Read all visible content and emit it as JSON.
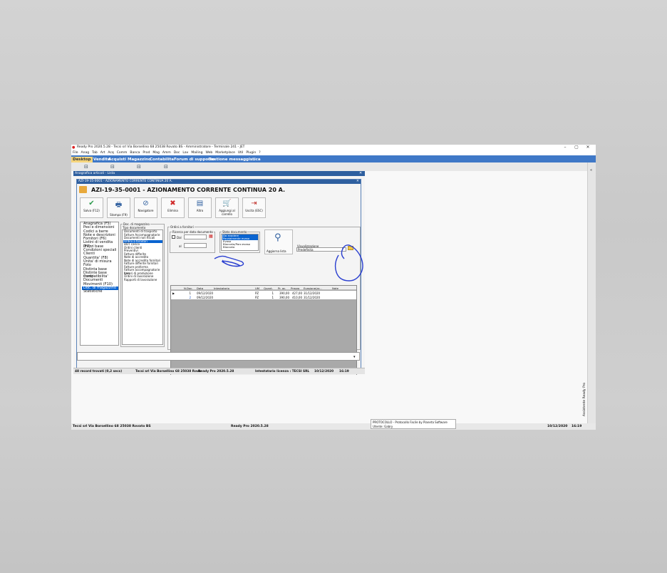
{
  "window": {
    "title": "Ready Pro 2020.5.28 - Tecsi srl Via Borsellino 68 25038 Rovato BS - Amministratore - Terminale 241 - JET",
    "controls": [
      "–",
      "▢",
      "✕"
    ]
  },
  "menubar": [
    "File",
    "Anag",
    "Tab",
    "Art",
    "Acq",
    "Comm",
    "Banca",
    "Prod",
    "Mag",
    "Amm",
    "Doc",
    "Lav",
    "Mailing",
    "Web",
    "Marketplace",
    "Util",
    "Plugin",
    "?"
  ],
  "tabs": [
    "Desktop",
    "Vendite",
    "Acquisti",
    "Magazzino",
    "Contabilita'",
    "Forum di supporto",
    "Gestione messaggistica",
    "..."
  ],
  "list_window": {
    "title": "Anagrafica articoli - Lista"
  },
  "detail_window": {
    "title": "AZI-19-35-0001 - AZIONAMENTO CORRENTE CONTINUA 20 A.",
    "heading": "AZI-19-35-0001 - AZIONAMENTO CORRENTE CONTINUA 20 A."
  },
  "toolbar": [
    {
      "icon": "check-icon",
      "glyph": "✔",
      "color": "#2e9b4e",
      "label": "Salva (F12)"
    },
    {
      "icon": "printer-icon",
      "glyph": "🖶",
      "color": "#2f5f9f",
      "label": "Stampa (F9)"
    },
    {
      "icon": "compass-icon",
      "glyph": "⊘",
      "color": "#2f5f9f",
      "label": "Navigatore"
    },
    {
      "icon": "close-icon",
      "glyph": "✖",
      "color": "#d02a2a",
      "label": "Elimina"
    },
    {
      "icon": "document-icon",
      "glyph": "▤",
      "color": "#2f5f9f",
      "label": "Altro"
    },
    {
      "icon": "cart-icon",
      "glyph": "🛒",
      "color": "#2f5f9f",
      "label": "Aggiungi al carrello"
    },
    {
      "icon": "exit-icon",
      "glyph": "⇥",
      "color": "#c0302a",
      "label": "Uscita (ESC)"
    }
  ],
  "nav": {
    "items": [
      "Anagrafica (F5)",
      "Pesi e dimensioni",
      "Codici a barre",
      "Note e descrizioni",
      "Fornitori (F6)",
      "Listini di vendita (F7)",
      "Prezzi base",
      "Condizioni speciali",
      "Clienti",
      "Quantita' (F8)",
      "Unita' di misura",
      "Foto",
      "Distinta base",
      "Distinte base madri",
      "Compatibilita'",
      "Documenti",
      "Movimenti (F10)",
      "Doc. di magazzino",
      "Statistiche"
    ],
    "selected": 17
  },
  "doc_types": {
    "group_title": "Doc. di magazzino",
    "header": "Tipo documento",
    "items": [
      "Documenti di trasporto",
      "Fatture Accompagnatorie",
      "Documenti non fiscali",
      "Ordini a fornitori",
      "DDT carico",
      "Ordini clienti",
      "Preventivi",
      "Fatture differite",
      "Note di accredito",
      "Note di accredito fornitori",
      "Fatture differite fornitori",
      "Fatture proforma",
      "Fatture accompagnatorie forn",
      "Lavori di produzione",
      "Ordini di lavorazione",
      "Rapporti di lavorazione"
    ],
    "selected": 3
  },
  "filters": {
    "group_title": "Ordini a fornitori",
    "ricerca_title": "Ricerca per data documento",
    "dal_label": "Dal",
    "al_label": "al",
    "stato_title": "Stato documento",
    "stato_items": [
      "Da evadere",
      "Parzialmente evaso",
      "Evaso",
      "Bloccato/Parz.evaso",
      "Bloccato"
    ],
    "stato_selected": [
      0,
      1
    ],
    "refresh_label": "Aggiorna lista",
    "visualizzazione_label": "Visualizzazione",
    "visualizzazione_value": "Predefinita"
  },
  "grid": {
    "columns": [
      "N.Doc.",
      "Data",
      "Intestatario",
      "UM",
      "Quant.",
      "Pr. ac.",
      "Prezzo",
      "Evasione(ar...",
      "Note"
    ],
    "rows": [
      [
        "1",
        "09/12/2020",
        "",
        "PZ",
        "1",
        "390,00",
        "427,00",
        "31/12/2020",
        ""
      ],
      [
        "2",
        "09/12/2020",
        "",
        "PZ",
        "1",
        "390,00",
        "410,00",
        "31/12/2020",
        ""
      ]
    ]
  },
  "status": {
    "records": "48 record trovati (0,2 secs)",
    "company": "Tecsi srl Via Borsellino 68 25038 Rova",
    "version": "Ready Pro 2020.5.28",
    "licensee": "Intestatario licenza : TECSI SRL",
    "date": "10/12/2020",
    "time": "16:19"
  },
  "bottom_bar": {
    "company": "Tecsi srl Via Borsellino 68 25038 Rovato BS",
    "version": "Ready Pro 2020.5.28",
    "toast_title": "PROTOCOLLO - Protocollo Facile by Pianeta Software",
    "toast_sub": "Utente: Gabry",
    "date": "10/12/2020",
    "time": "16:19"
  },
  "side_label": "Assistente Ready Pro",
  "annotation_color": "#2a3fd0"
}
